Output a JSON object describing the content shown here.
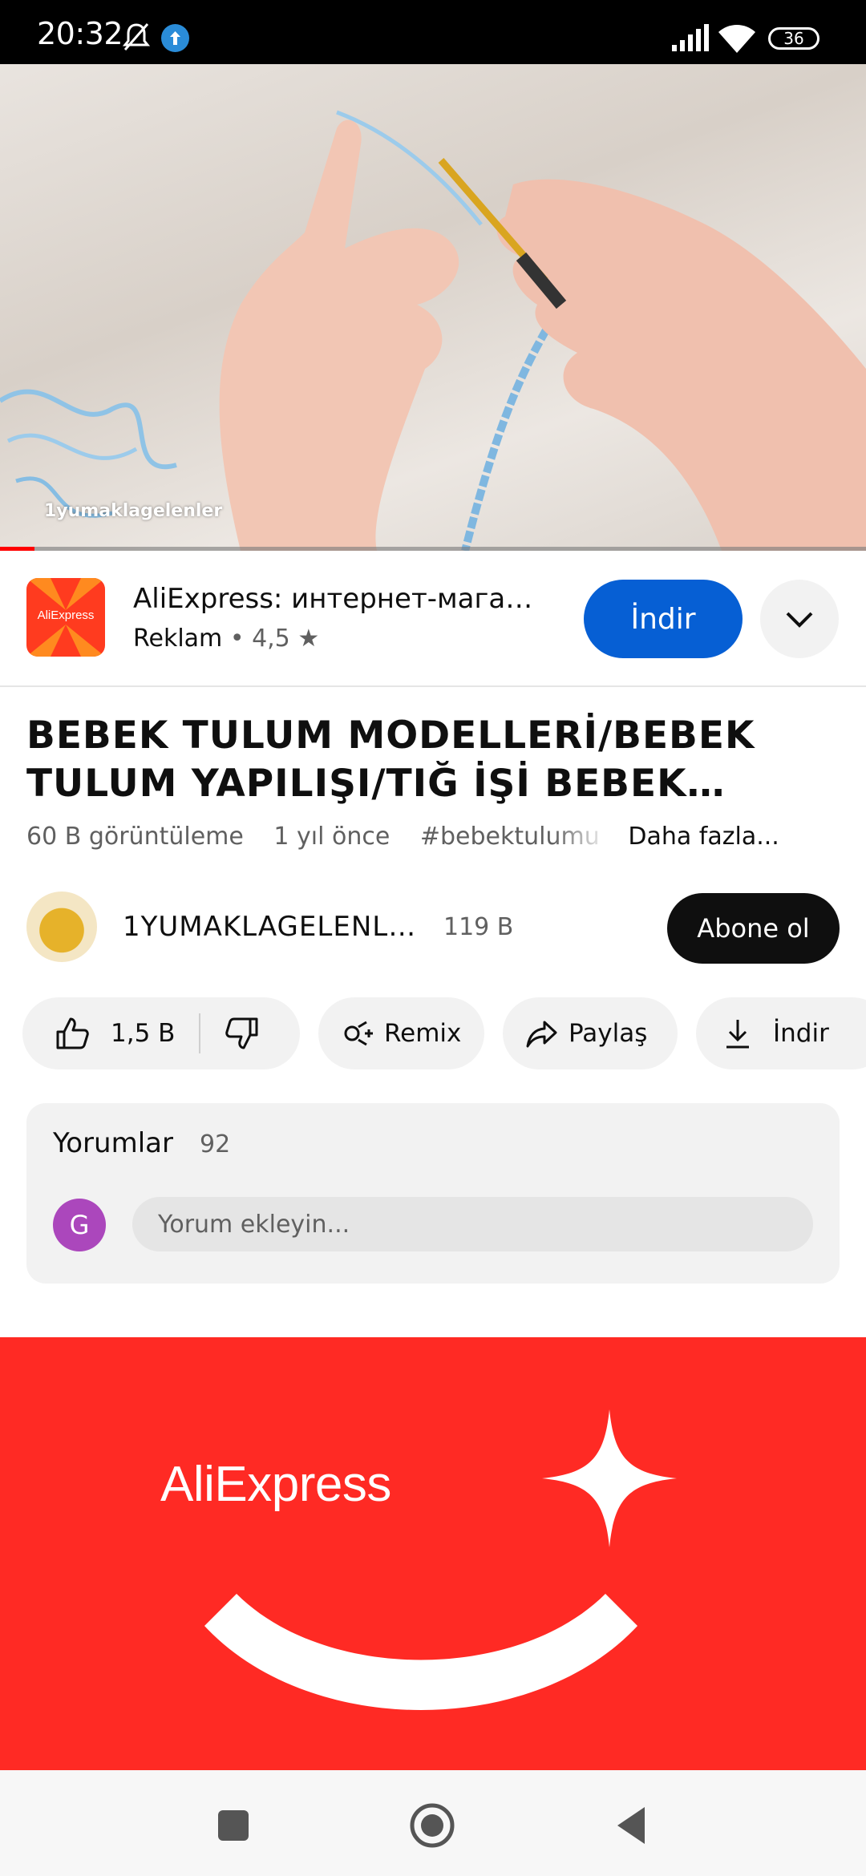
{
  "status_bar": {
    "time": "20:32",
    "battery": "36"
  },
  "video": {
    "watermark": "1yumaklagelenler",
    "progress_fraction": 0.04
  },
  "ad": {
    "logo_text": "AliExpress",
    "title": "AliExpress: интернет-мага…",
    "label": "Reklam",
    "rating": "4,5",
    "install_label": "İndir"
  },
  "video_info": {
    "title": "BEBEK TULUM MODELLERİ/BEBEK TULUM YAPILIŞI/TIĞ İŞİ BEBEK TULU…",
    "views": "60 B görüntüleme",
    "age": "1 yıl önce",
    "hashtag": "#bebektulumu",
    "more": "Daha fazla..."
  },
  "channel": {
    "name": "1YUMAKLAGELENL…",
    "subscribers": "119 B",
    "subscribe_label": "Abone ol"
  },
  "actions": {
    "like_count": "1,5 B",
    "remix_label": "Remix",
    "share_label": "Paylaş",
    "download_label": "İndir"
  },
  "comments": {
    "title": "Yorumlar",
    "count": "92",
    "avatar_letter": "G",
    "placeholder": "Yorum ekleyin..."
  },
  "banner": {
    "logo_text": "AliExpress"
  },
  "colors": {
    "youtube_red": "#ff0000",
    "install_blue": "#065fd4",
    "aliexpress_red": "#ff2a24",
    "avatar_purple": "#ab47bc"
  }
}
